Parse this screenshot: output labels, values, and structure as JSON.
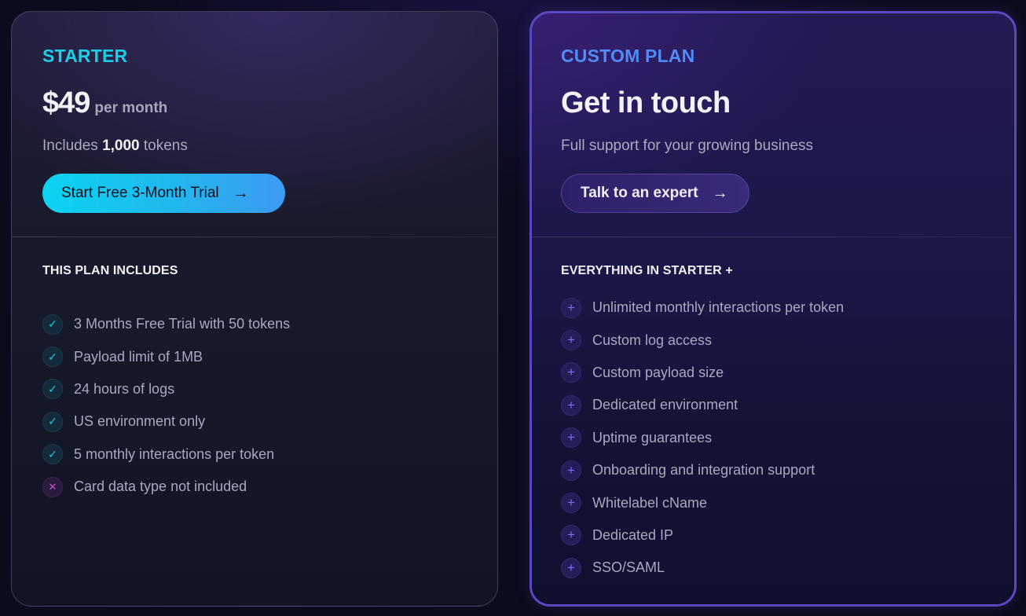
{
  "starter": {
    "plan_name": "STARTER",
    "price": "$49",
    "price_period": "per month",
    "includes_prefix": "Includes",
    "includes_amount": "1,000",
    "includes_suffix": "tokens",
    "cta_label": "Start Free 3-Month Trial",
    "cta_icon": "arrow-right-icon",
    "section_title": "THIS PLAN INCLUDES",
    "features": [
      {
        "label": "3 Months Free Trial with 50 tokens",
        "icon": "check-icon",
        "included": true
      },
      {
        "label": "Payload limit of 1MB",
        "icon": "check-icon",
        "included": true
      },
      {
        "label": "24 hours of logs",
        "icon": "check-icon",
        "included": true
      },
      {
        "label": "US environment only",
        "icon": "check-icon",
        "included": true
      },
      {
        "label": "5 monthly interactions per token",
        "icon": "check-icon",
        "included": true
      },
      {
        "label": "Card data type not included",
        "icon": "x-icon",
        "included": false
      }
    ],
    "accent_color": "#1ccde6"
  },
  "custom": {
    "plan_name": "CUSTOM PLAN",
    "headline": "Get in touch",
    "subtitle": "Full support for your growing business",
    "cta_label": "Talk to an expert",
    "cta_icon": "arrow-right-icon",
    "section_title": "EVERYTHING IN STARTER +",
    "features": [
      {
        "label": "Unlimited monthly interactions per token",
        "icon": "plus-icon"
      },
      {
        "label": "Custom log access",
        "icon": "plus-icon"
      },
      {
        "label": "Custom payload size",
        "icon": "plus-icon"
      },
      {
        "label": "Dedicated environment",
        "icon": "plus-icon"
      },
      {
        "label": "Uptime guarantees",
        "icon": "plus-icon"
      },
      {
        "label": "Onboarding and integration support",
        "icon": "plus-icon"
      },
      {
        "label": "Whitelabel cName",
        "icon": "plus-icon"
      },
      {
        "label": "Dedicated IP",
        "icon": "plus-icon"
      },
      {
        "label": "SSO/SAML",
        "icon": "plus-icon"
      }
    ],
    "accent_color": "#4f8cf5",
    "border_color": "#5a48c0"
  },
  "glyphs": {
    "arrow": "→",
    "check": "✓",
    "x": "✕",
    "plus": "+"
  }
}
